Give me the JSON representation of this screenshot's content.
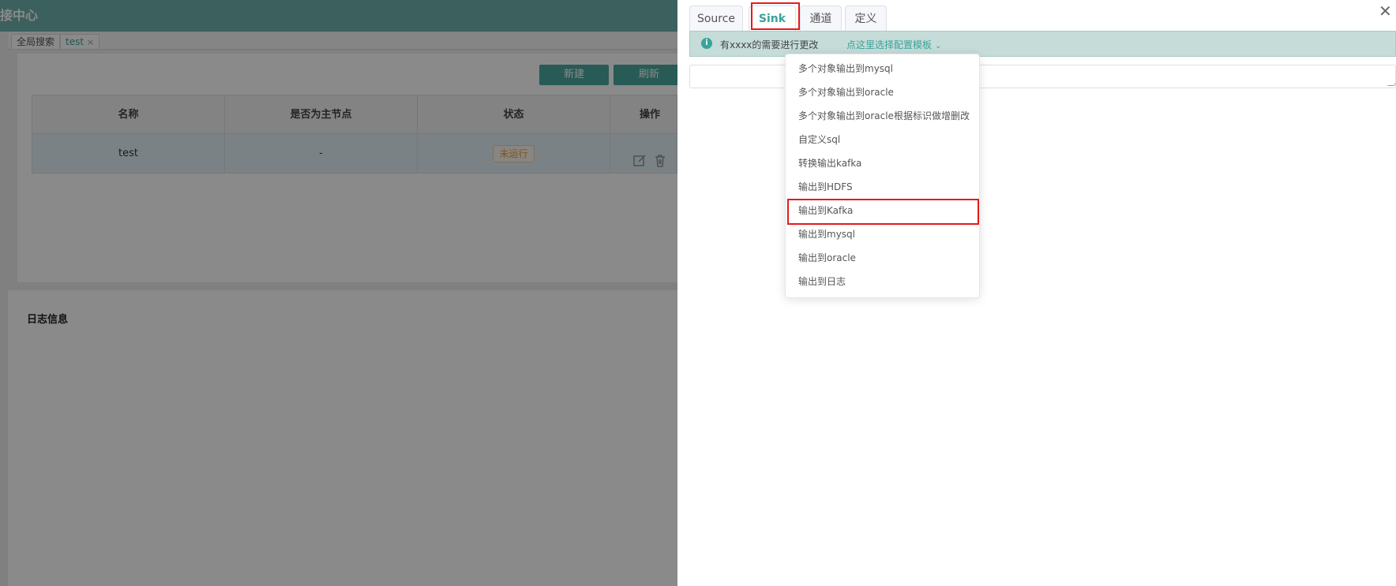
{
  "app": {
    "title": "对接中心",
    "page_tabs": [
      {
        "label": "全局搜索",
        "closable": false,
        "active": false
      },
      {
        "label": "test",
        "closable": true,
        "active": true
      }
    ],
    "toolbar": {
      "new_label": "新建",
      "refresh_label": "刷新"
    },
    "table": {
      "headers": [
        "名称",
        "是否为主节点",
        "状态",
        "操作"
      ],
      "rows": [
        {
          "name": "test",
          "is_master": "-",
          "status": "未运行",
          "actions": [
            "edit-icon",
            "delete-icon"
          ]
        }
      ]
    },
    "log_section_title": "日志信息"
  },
  "drawer": {
    "tabs": [
      {
        "label": "Source",
        "active": false
      },
      {
        "label": "Sink",
        "active": true
      },
      {
        "label": "通道",
        "active": false
      },
      {
        "label": "定义",
        "active": false
      }
    ],
    "close_icon": "close-icon",
    "alert": {
      "icon": "info-icon",
      "text": "有xxxx的需要进行更改",
      "link_text": "点这里选择配置模板",
      "link_icon": "chevron-down-icon"
    },
    "config_textarea_value": "",
    "template_menu": {
      "items": [
        "多个对象输出到mysql",
        "多个对象输出到oracle",
        "多个对象输出到oracle根据标识做增删改",
        "自定义sql",
        "转换输出kafka",
        "输出到HDFS",
        "输出到Kafka",
        "输出到mysql",
        "输出到oracle",
        "输出到日志"
      ],
      "highlighted": "输出到Kafka"
    }
  },
  "colors": {
    "accent": "#3aa39b",
    "highlight_border": "#e51a1a",
    "status_badge": "#e6a23c"
  }
}
